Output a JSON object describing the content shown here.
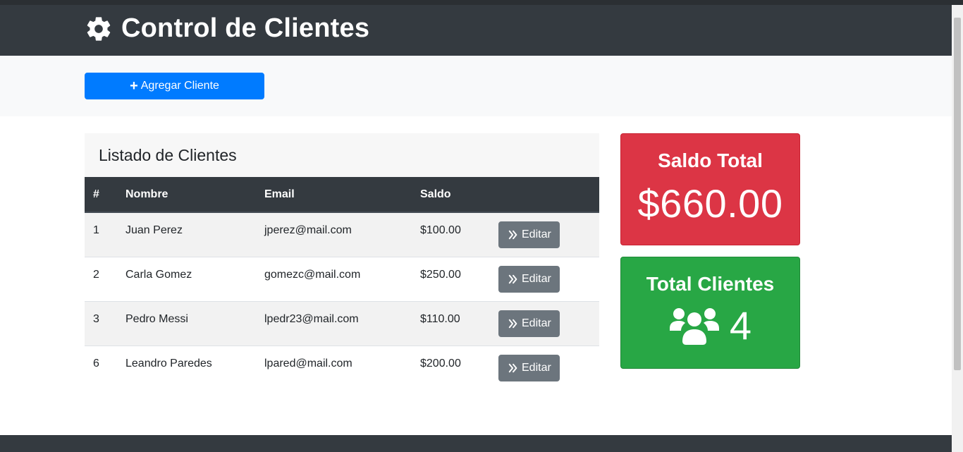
{
  "header": {
    "title": "Control de Clientes",
    "icon": "gear-icon"
  },
  "actions": {
    "add_label": "Agregar Cliente",
    "add_icon": "plus-icon",
    "accent": "#007bff"
  },
  "list": {
    "title": "Listado de Clientes",
    "columns": [
      "#",
      "Nombre",
      "Email",
      "Saldo"
    ],
    "rows": [
      {
        "id": "1",
        "nombre": "Juan Perez",
        "email": "jperez@mail.com",
        "saldo": "$100.00",
        "action": "Editar"
      },
      {
        "id": "2",
        "nombre": "Carla Gomez",
        "email": "gomezc@mail.com",
        "saldo": "$250.00",
        "action": "Editar"
      },
      {
        "id": "3",
        "nombre": "Pedro Messi",
        "email": "lpedr23@mail.com",
        "saldo": "$110.00",
        "action": "Editar"
      },
      {
        "id": "6",
        "nombre": "Leandro Paredes",
        "email": "lpared@mail.com",
        "saldo": "$200.00",
        "action": "Editar"
      }
    ]
  },
  "stats": {
    "saldo_total": {
      "label": "Saldo Total",
      "value": "$660.00",
      "color": "#dc3545"
    },
    "total_clientes": {
      "label": "Total Clientes",
      "value": "4",
      "icon": "users-icon",
      "color": "#28a745"
    }
  }
}
